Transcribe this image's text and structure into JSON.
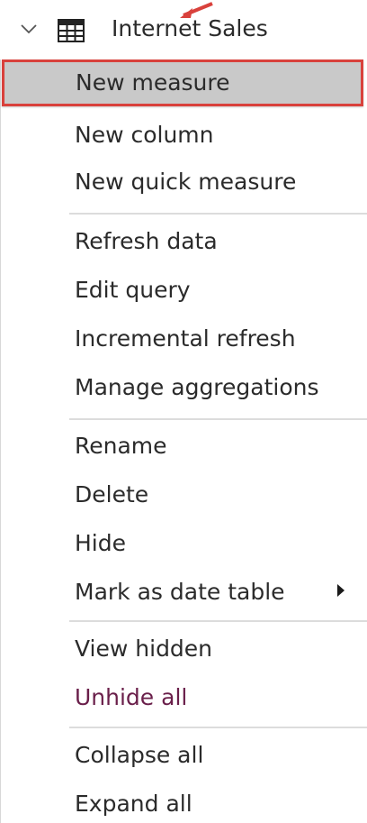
{
  "header": {
    "label": "Internet Sales",
    "chevron_icon": "chevron-down-icon",
    "table_icon": "table-icon"
  },
  "annotation": {
    "arrow_color": "#d9413c"
  },
  "menu": {
    "highlight_color": "#d9413c",
    "groups": [
      {
        "items": [
          {
            "label": "New measure",
            "highlighted": true
          },
          {
            "label": "New column"
          },
          {
            "label": "New quick measure"
          }
        ]
      },
      {
        "items": [
          {
            "label": "Refresh data"
          },
          {
            "label": "Edit query"
          },
          {
            "label": "Incremental refresh"
          },
          {
            "label": "Manage aggregations"
          }
        ]
      },
      {
        "items": [
          {
            "label": "Rename"
          },
          {
            "label": "Delete"
          },
          {
            "label": "Hide"
          },
          {
            "label": "Mark as date table",
            "submenu": true
          }
        ]
      },
      {
        "items": [
          {
            "label": "View hidden"
          },
          {
            "label": "Unhide all"
          }
        ]
      },
      {
        "items": [
          {
            "label": "Collapse all"
          },
          {
            "label": "Expand all"
          }
        ]
      }
    ]
  }
}
